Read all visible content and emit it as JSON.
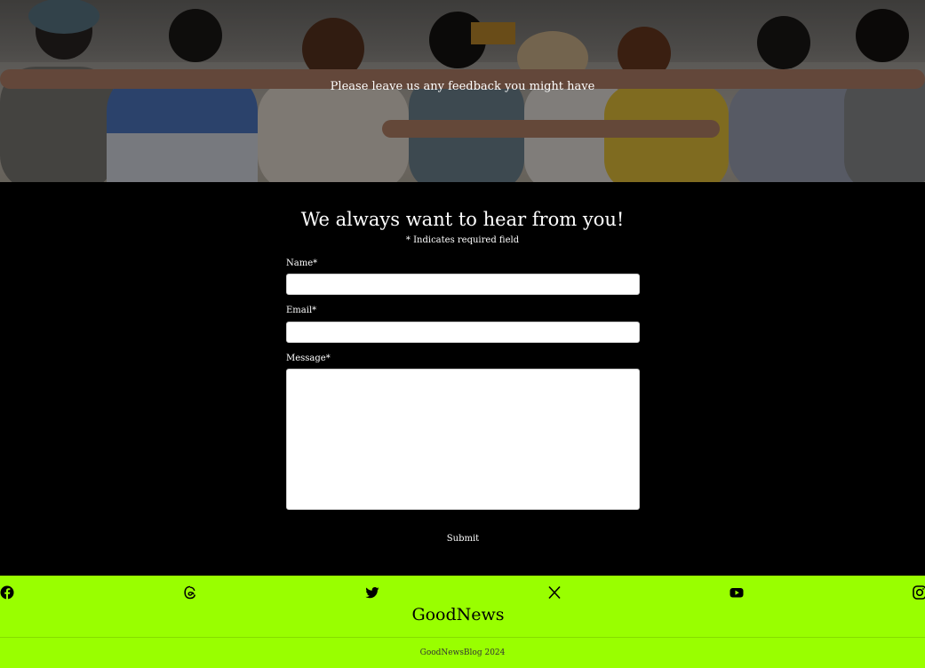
{
  "hero": {
    "tagline": "Please leave us any feedback you might have"
  },
  "form": {
    "heading": "We always want to hear from you!",
    "required_note": "* Indicates required field",
    "fields": {
      "name_label": "Name*",
      "name_value": "",
      "email_label": "Email*",
      "email_value": "",
      "message_label": "Message*",
      "message_value": ""
    },
    "submit_label": "Submit"
  },
  "footer": {
    "social_icons": [
      "facebook-icon",
      "threads-icon",
      "twitter-icon",
      "x-icon",
      "youtube-icon",
      "instagram-icon"
    ],
    "brand": "GoodNews",
    "copyright": "GoodNewsBlog 2024"
  },
  "colors": {
    "footer_background": "#99ff00",
    "form_background": "#000000",
    "text": "#ffffff"
  }
}
